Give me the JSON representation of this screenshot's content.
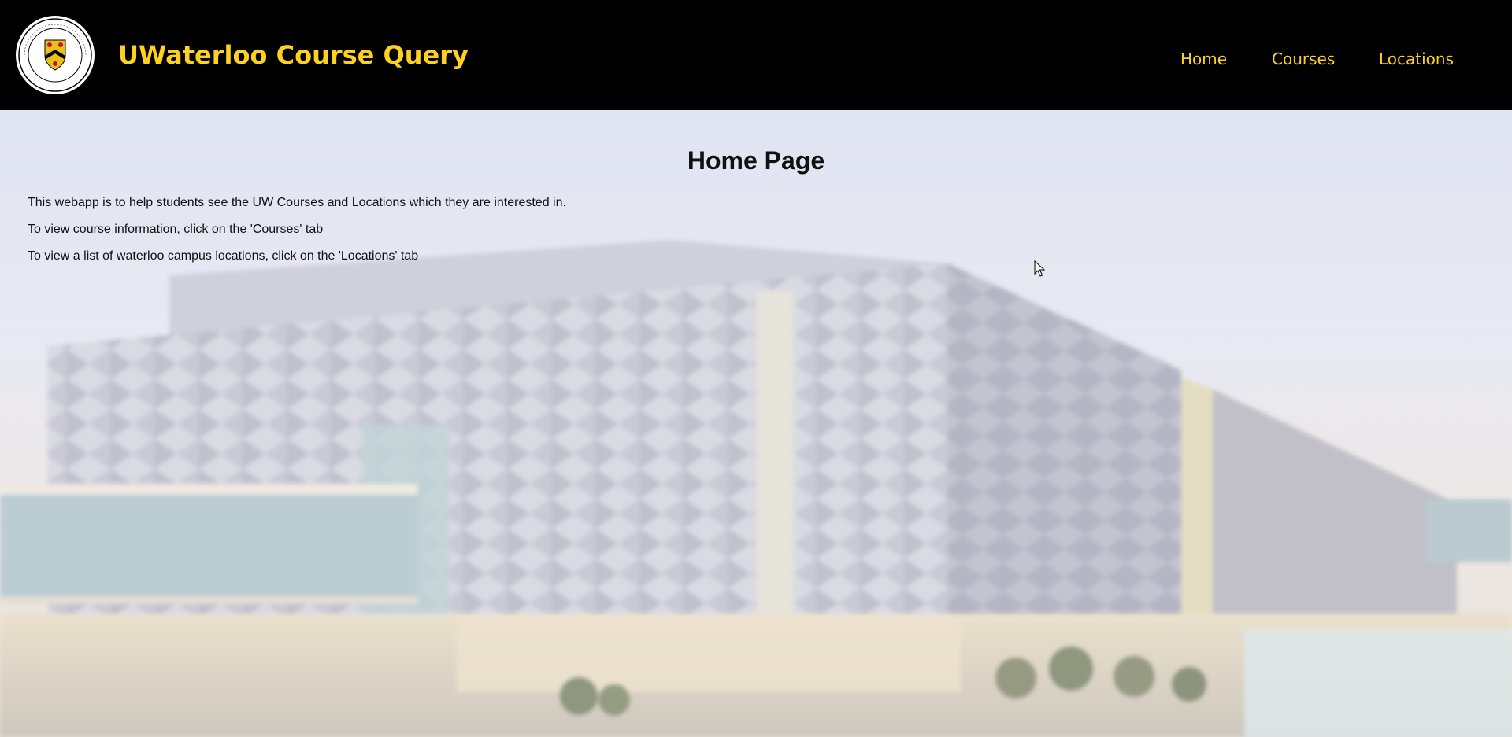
{
  "header": {
    "title": "UWaterloo Course Query",
    "logo_alt": "University of Waterloo crest"
  },
  "nav": {
    "items": [
      {
        "label": "Home"
      },
      {
        "label": "Courses"
      },
      {
        "label": "Locations"
      }
    ]
  },
  "main": {
    "heading": "Home Page",
    "paragraphs": [
      "This webapp is to help students see the UW Courses and Locations which they are interested in.",
      "To view course information, click on the 'Courses' tab",
      "To view a list of waterloo campus locations, click on the 'Locations' tab"
    ]
  },
  "colors": {
    "header_bg": "#000000",
    "accent": "#ffd11f",
    "text": "#111111"
  },
  "icons": {
    "logo": "university-crest-icon",
    "cursor": "mouse-pointer-icon"
  }
}
